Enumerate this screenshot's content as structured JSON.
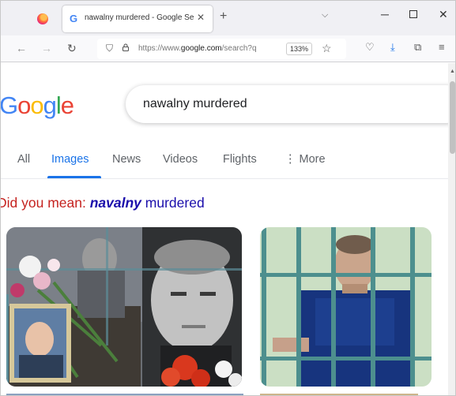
{
  "browser": {
    "tab": {
      "favicon": "G",
      "title": "nawalny murdered - Google Se…"
    },
    "toolbar": {
      "url_prefix": "https://www.",
      "url_domain": "google.com",
      "url_suffix": "/search?q",
      "zoom": "133%"
    }
  },
  "google": {
    "logo": [
      "G",
      "o",
      "o",
      "g",
      "l",
      "e"
    ],
    "logo_colors": [
      "#4285f4",
      "#ea4335",
      "#fbbc05",
      "#4285f4",
      "#34a853",
      "#ea4335"
    ],
    "query": "nawalny murdered",
    "tabs": [
      {
        "label": "All"
      },
      {
        "label": "Images"
      },
      {
        "label": "News"
      },
      {
        "label": "Videos"
      },
      {
        "label": "Flights"
      },
      {
        "label": "More"
      }
    ],
    "did_you_mean": {
      "label": "Did you mean:",
      "bold": "navalny",
      "rest": "murdered"
    }
  },
  "colors": {
    "accent": "#1a73e8",
    "link": "#1a0dab",
    "suggestion": "#c5221f"
  }
}
